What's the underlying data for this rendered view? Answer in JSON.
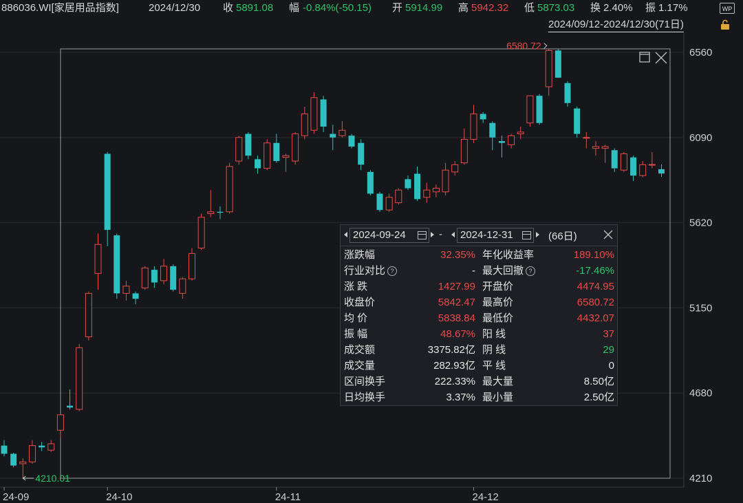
{
  "header": {
    "code_name": "886036.WI[家居用品指数]",
    "date": "2024/12/30",
    "close_label": "收",
    "close_value": "5891.08",
    "change_label": "幅",
    "change_value": "-0.84%(-50.15)",
    "open_label": "开",
    "open_value": "5914.99",
    "high_label": "高",
    "high_value": "5942.32",
    "low_label": "低",
    "low_value": "5873.03",
    "turnover_label": "换",
    "turnover_value": "2.40%",
    "amplitude_label": "振",
    "amplitude_value": "1.17%",
    "wp_label": "WP"
  },
  "range_text": "2024/09/12-2024/12/30(71日)",
  "colors": {
    "up": "#e84a4a",
    "down": "#2fc1c1",
    "green_text": "#2fc26b",
    "bg": "#16171a"
  },
  "chart_data": {
    "type": "candlestick",
    "yticks": [
      4210,
      4680,
      5150,
      5620,
      6090,
      6560
    ],
    "ylim": [
      4210,
      6560
    ],
    "xticks": [
      "24-09",
      "24-10",
      "24-11",
      "24-12"
    ],
    "max_label": "6580.72",
    "min_label": "4210.01",
    "candles": [
      {
        "date": "2024-09-12",
        "o": 4390,
        "h": 4420,
        "l": 4330,
        "c": 4345
      },
      {
        "date": "2024-09-13",
        "o": 4345,
        "h": 4350,
        "l": 4270,
        "c": 4280
      },
      {
        "date": "2024-09-18",
        "o": 4290,
        "h": 4320,
        "l": 4210.01,
        "c": 4300
      },
      {
        "date": "2024-09-19",
        "o": 4300,
        "h": 4420,
        "l": 4290,
        "c": 4390
      },
      {
        "date": "2024-09-20",
        "o": 4390,
        "h": 4410,
        "l": 4360,
        "c": 4380
      },
      {
        "date": "2024-09-23",
        "o": 4365,
        "h": 4420,
        "l": 4355,
        "c": 4400
      },
      {
        "date": "2024-09-24",
        "o": 4474.95,
        "h": 4560,
        "l": 4432.07,
        "c": 4560
      },
      {
        "date": "2024-09-25",
        "o": 4610,
        "h": 4700,
        "l": 4590,
        "c": 4600
      },
      {
        "date": "2024-09-26",
        "o": 4590,
        "h": 4950,
        "l": 4580,
        "c": 4930
      },
      {
        "date": "2024-09-27",
        "o": 4990,
        "h": 5240,
        "l": 4970,
        "c": 5230
      },
      {
        "date": "2024-09-30",
        "o": 5340,
        "h": 5560,
        "l": 5250,
        "c": 5500
      },
      {
        "date": "2024-10-08",
        "o": 6000,
        "h": 6010,
        "l": 5490,
        "c": 5580
      },
      {
        "date": "2024-10-09",
        "o": 5550,
        "h": 5560,
        "l": 5200,
        "c": 5230
      },
      {
        "date": "2024-10-10",
        "o": 5230,
        "h": 5300,
        "l": 5190,
        "c": 5270
      },
      {
        "date": "2024-10-11",
        "o": 5230,
        "h": 5240,
        "l": 5170,
        "c": 5200
      },
      {
        "date": "2024-10-14",
        "o": 5260,
        "h": 5380,
        "l": 5250,
        "c": 5370
      },
      {
        "date": "2024-10-15",
        "o": 5360,
        "h": 5380,
        "l": 5260,
        "c": 5290
      },
      {
        "date": "2024-10-16",
        "o": 5300,
        "h": 5420,
        "l": 5280,
        "c": 5380
      },
      {
        "date": "2024-10-17",
        "o": 5380,
        "h": 5390,
        "l": 5240,
        "c": 5250
      },
      {
        "date": "2024-10-18",
        "o": 5230,
        "h": 5320,
        "l": 5200,
        "c": 5310
      },
      {
        "date": "2024-10-21",
        "o": 5310,
        "h": 5480,
        "l": 5300,
        "c": 5450
      },
      {
        "date": "2024-10-22",
        "o": 5480,
        "h": 5670,
        "l": 5470,
        "c": 5650
      },
      {
        "date": "2024-10-23",
        "o": 5670,
        "h": 5800,
        "l": 5650,
        "c": 5680
      },
      {
        "date": "2024-10-24",
        "o": 5680,
        "h": 5710,
        "l": 5640,
        "c": 5675
      },
      {
        "date": "2024-10-25",
        "o": 5680,
        "h": 5950,
        "l": 5670,
        "c": 5930
      },
      {
        "date": "2024-10-28",
        "o": 5960,
        "h": 6100,
        "l": 5940,
        "c": 6090
      },
      {
        "date": "2024-10-29",
        "o": 6110,
        "h": 6120,
        "l": 5970,
        "c": 5990
      },
      {
        "date": "2024-10-30",
        "o": 5970,
        "h": 5990,
        "l": 5890,
        "c": 5920
      },
      {
        "date": "2024-10-31",
        "o": 5920,
        "h": 6080,
        "l": 5910,
        "c": 6060
      },
      {
        "date": "2024-11-01",
        "o": 6060,
        "h": 6110,
        "l": 5950,
        "c": 5960
      },
      {
        "date": "2024-11-04",
        "o": 5980,
        "h": 6000,
        "l": 5900,
        "c": 5990
      },
      {
        "date": "2024-11-05",
        "o": 5960,
        "h": 6120,
        "l": 5940,
        "c": 6110
      },
      {
        "date": "2024-11-06",
        "o": 6100,
        "h": 6260,
        "l": 6080,
        "c": 6220
      },
      {
        "date": "2024-11-07",
        "o": 6130,
        "h": 6340,
        "l": 6110,
        "c": 6310
      },
      {
        "date": "2024-11-08",
        "o": 6300,
        "h": 6320,
        "l": 6120,
        "c": 6150
      },
      {
        "date": "2024-11-11",
        "o": 6110,
        "h": 6160,
        "l": 6020,
        "c": 6090
      },
      {
        "date": "2024-11-12",
        "o": 6100,
        "h": 6180,
        "l": 6090,
        "c": 6130
      },
      {
        "date": "2024-11-13",
        "o": 6100,
        "h": 6110,
        "l": 6030,
        "c": 6040
      },
      {
        "date": "2024-11-14",
        "o": 6060,
        "h": 6080,
        "l": 5910,
        "c": 5940
      },
      {
        "date": "2024-11-15",
        "o": 5900,
        "h": 5910,
        "l": 5770,
        "c": 5780
      },
      {
        "date": "2024-11-18",
        "o": 5780,
        "h": 5790,
        "l": 5680,
        "c": 5690
      },
      {
        "date": "2024-11-19",
        "o": 5690,
        "h": 5780,
        "l": 5680,
        "c": 5760
      },
      {
        "date": "2024-11-20",
        "o": 5730,
        "h": 5810,
        "l": 5720,
        "c": 5800
      },
      {
        "date": "2024-11-21",
        "o": 5860,
        "h": 5880,
        "l": 5800,
        "c": 5810
      },
      {
        "date": "2024-11-22",
        "o": 5890,
        "h": 5930,
        "l": 5740,
        "c": 5750
      },
      {
        "date": "2024-11-25",
        "o": 5760,
        "h": 5840,
        "l": 5730,
        "c": 5800
      },
      {
        "date": "2024-11-26",
        "o": 5790,
        "h": 5830,
        "l": 5760,
        "c": 5810
      },
      {
        "date": "2024-11-27",
        "o": 5790,
        "h": 5950,
        "l": 5770,
        "c": 5910
      },
      {
        "date": "2024-11-28",
        "o": 5900,
        "h": 5960,
        "l": 5880,
        "c": 5940
      },
      {
        "date": "2024-11-29",
        "o": 5950,
        "h": 6140,
        "l": 5940,
        "c": 6080
      },
      {
        "date": "2024-12-02",
        "o": 6080,
        "h": 6270,
        "l": 6060,
        "c": 6220
      },
      {
        "date": "2024-12-03",
        "o": 6220,
        "h": 6230,
        "l": 6170,
        "c": 6190
      },
      {
        "date": "2024-12-04",
        "o": 6170,
        "h": 6180,
        "l": 6020,
        "c": 6090
      },
      {
        "date": "2024-12-05",
        "o": 6070,
        "h": 6100,
        "l": 5980,
        "c": 6060
      },
      {
        "date": "2024-12-06",
        "o": 6050,
        "h": 6110,
        "l": 6030,
        "c": 6100
      },
      {
        "date": "2024-12-09",
        "o": 6110,
        "h": 6150,
        "l": 6080,
        "c": 6120
      },
      {
        "date": "2024-12-10",
        "o": 6170,
        "h": 6300,
        "l": 6150,
        "c": 6320
      },
      {
        "date": "2024-12-11",
        "o": 6320,
        "h": 6330,
        "l": 6160,
        "c": 6170
      },
      {
        "date": "2024-12-12",
        "o": 6370,
        "h": 6580.72,
        "l": 6320,
        "c": 6570
      },
      {
        "date": "2024-12-13",
        "o": 6570,
        "h": 6580,
        "l": 6420,
        "c": 6420
      },
      {
        "date": "2024-12-16",
        "o": 6390,
        "h": 6400,
        "l": 6260,
        "c": 6280
      },
      {
        "date": "2024-12-17",
        "o": 6250,
        "h": 6260,
        "l": 6090,
        "c": 6110
      },
      {
        "date": "2024-12-18",
        "o": 6090,
        "h": 6120,
        "l": 6030,
        "c": 6090
      },
      {
        "date": "2024-12-19",
        "o": 6030,
        "h": 6070,
        "l": 5990,
        "c": 6040
      },
      {
        "date": "2024-12-20",
        "o": 6030,
        "h": 6050,
        "l": 5950,
        "c": 6040
      },
      {
        "date": "2024-12-23",
        "o": 6020,
        "h": 6030,
        "l": 5900,
        "c": 5920
      },
      {
        "date": "2024-12-24",
        "o": 5910,
        "h": 6010,
        "l": 5900,
        "c": 6000
      },
      {
        "date": "2024-12-25",
        "o": 5980,
        "h": 5990,
        "l": 5850,
        "c": 5880
      },
      {
        "date": "2024-12-26",
        "o": 5880,
        "h": 5960,
        "l": 5870,
        "c": 5940
      },
      {
        "date": "2024-12-27",
        "o": 5940,
        "h": 6010,
        "l": 5920,
        "c": 5941
      },
      {
        "date": "2024-12-30",
        "o": 5914.99,
        "h": 5942.32,
        "l": 5873.03,
        "c": 5891.08
      }
    ]
  },
  "panel": {
    "start_date": "2024-09-24",
    "end_date": "2024-12-31",
    "dash": "-",
    "days": "(66日)",
    "rows": [
      {
        "k1": "涨跌幅",
        "v1": "32.35%",
        "c1": "red",
        "k2": "年化收益率",
        "v2": "189.10%",
        "c2": "red",
        "q1": false,
        "q2": false
      },
      {
        "k1": "行业对比",
        "v1": "-",
        "c1": "white",
        "k2": "最大回撤",
        "v2": "-17.46%",
        "c2": "grn",
        "q1": true,
        "q2": true
      },
      {
        "k1": "涨  跌",
        "v1": "1427.99",
        "c1": "red",
        "k2": "开盘价",
        "v2": "4474.95",
        "c2": "red",
        "q1": false,
        "q2": false
      },
      {
        "k1": "收盘价",
        "v1": "5842.47",
        "c1": "red",
        "k2": "最高价",
        "v2": "6580.72",
        "c2": "red",
        "q1": false,
        "q2": false
      },
      {
        "k1": "均  价",
        "v1": "5838.84",
        "c1": "red",
        "k2": "最低价",
        "v2": "4432.07",
        "c2": "red",
        "q1": false,
        "q2": false
      },
      {
        "k1": "振  幅",
        "v1": "48.67%",
        "c1": "red",
        "k2": "阳  线",
        "v2": "37",
        "c2": "red",
        "q1": false,
        "q2": false
      },
      {
        "k1": "成交额",
        "v1": "3375.82亿",
        "c1": "white",
        "k2": "阴  线",
        "v2": "29",
        "c2": "grn",
        "q1": false,
        "q2": false
      },
      {
        "k1": "成交量",
        "v1": "282.93亿",
        "c1": "white",
        "k2": "平  线",
        "v2": "0",
        "c2": "white",
        "q1": false,
        "q2": false
      },
      {
        "k1": "区间换手",
        "v1": "222.33%",
        "c1": "white",
        "k2": "最大量",
        "v2": "8.50亿",
        "c2": "white",
        "q1": false,
        "q2": false
      },
      {
        "k1": "日均换手",
        "v1": "3.37%",
        "c1": "white",
        "k2": "最小量",
        "v2": "2.50亿",
        "c2": "white",
        "q1": false,
        "q2": false
      }
    ]
  }
}
